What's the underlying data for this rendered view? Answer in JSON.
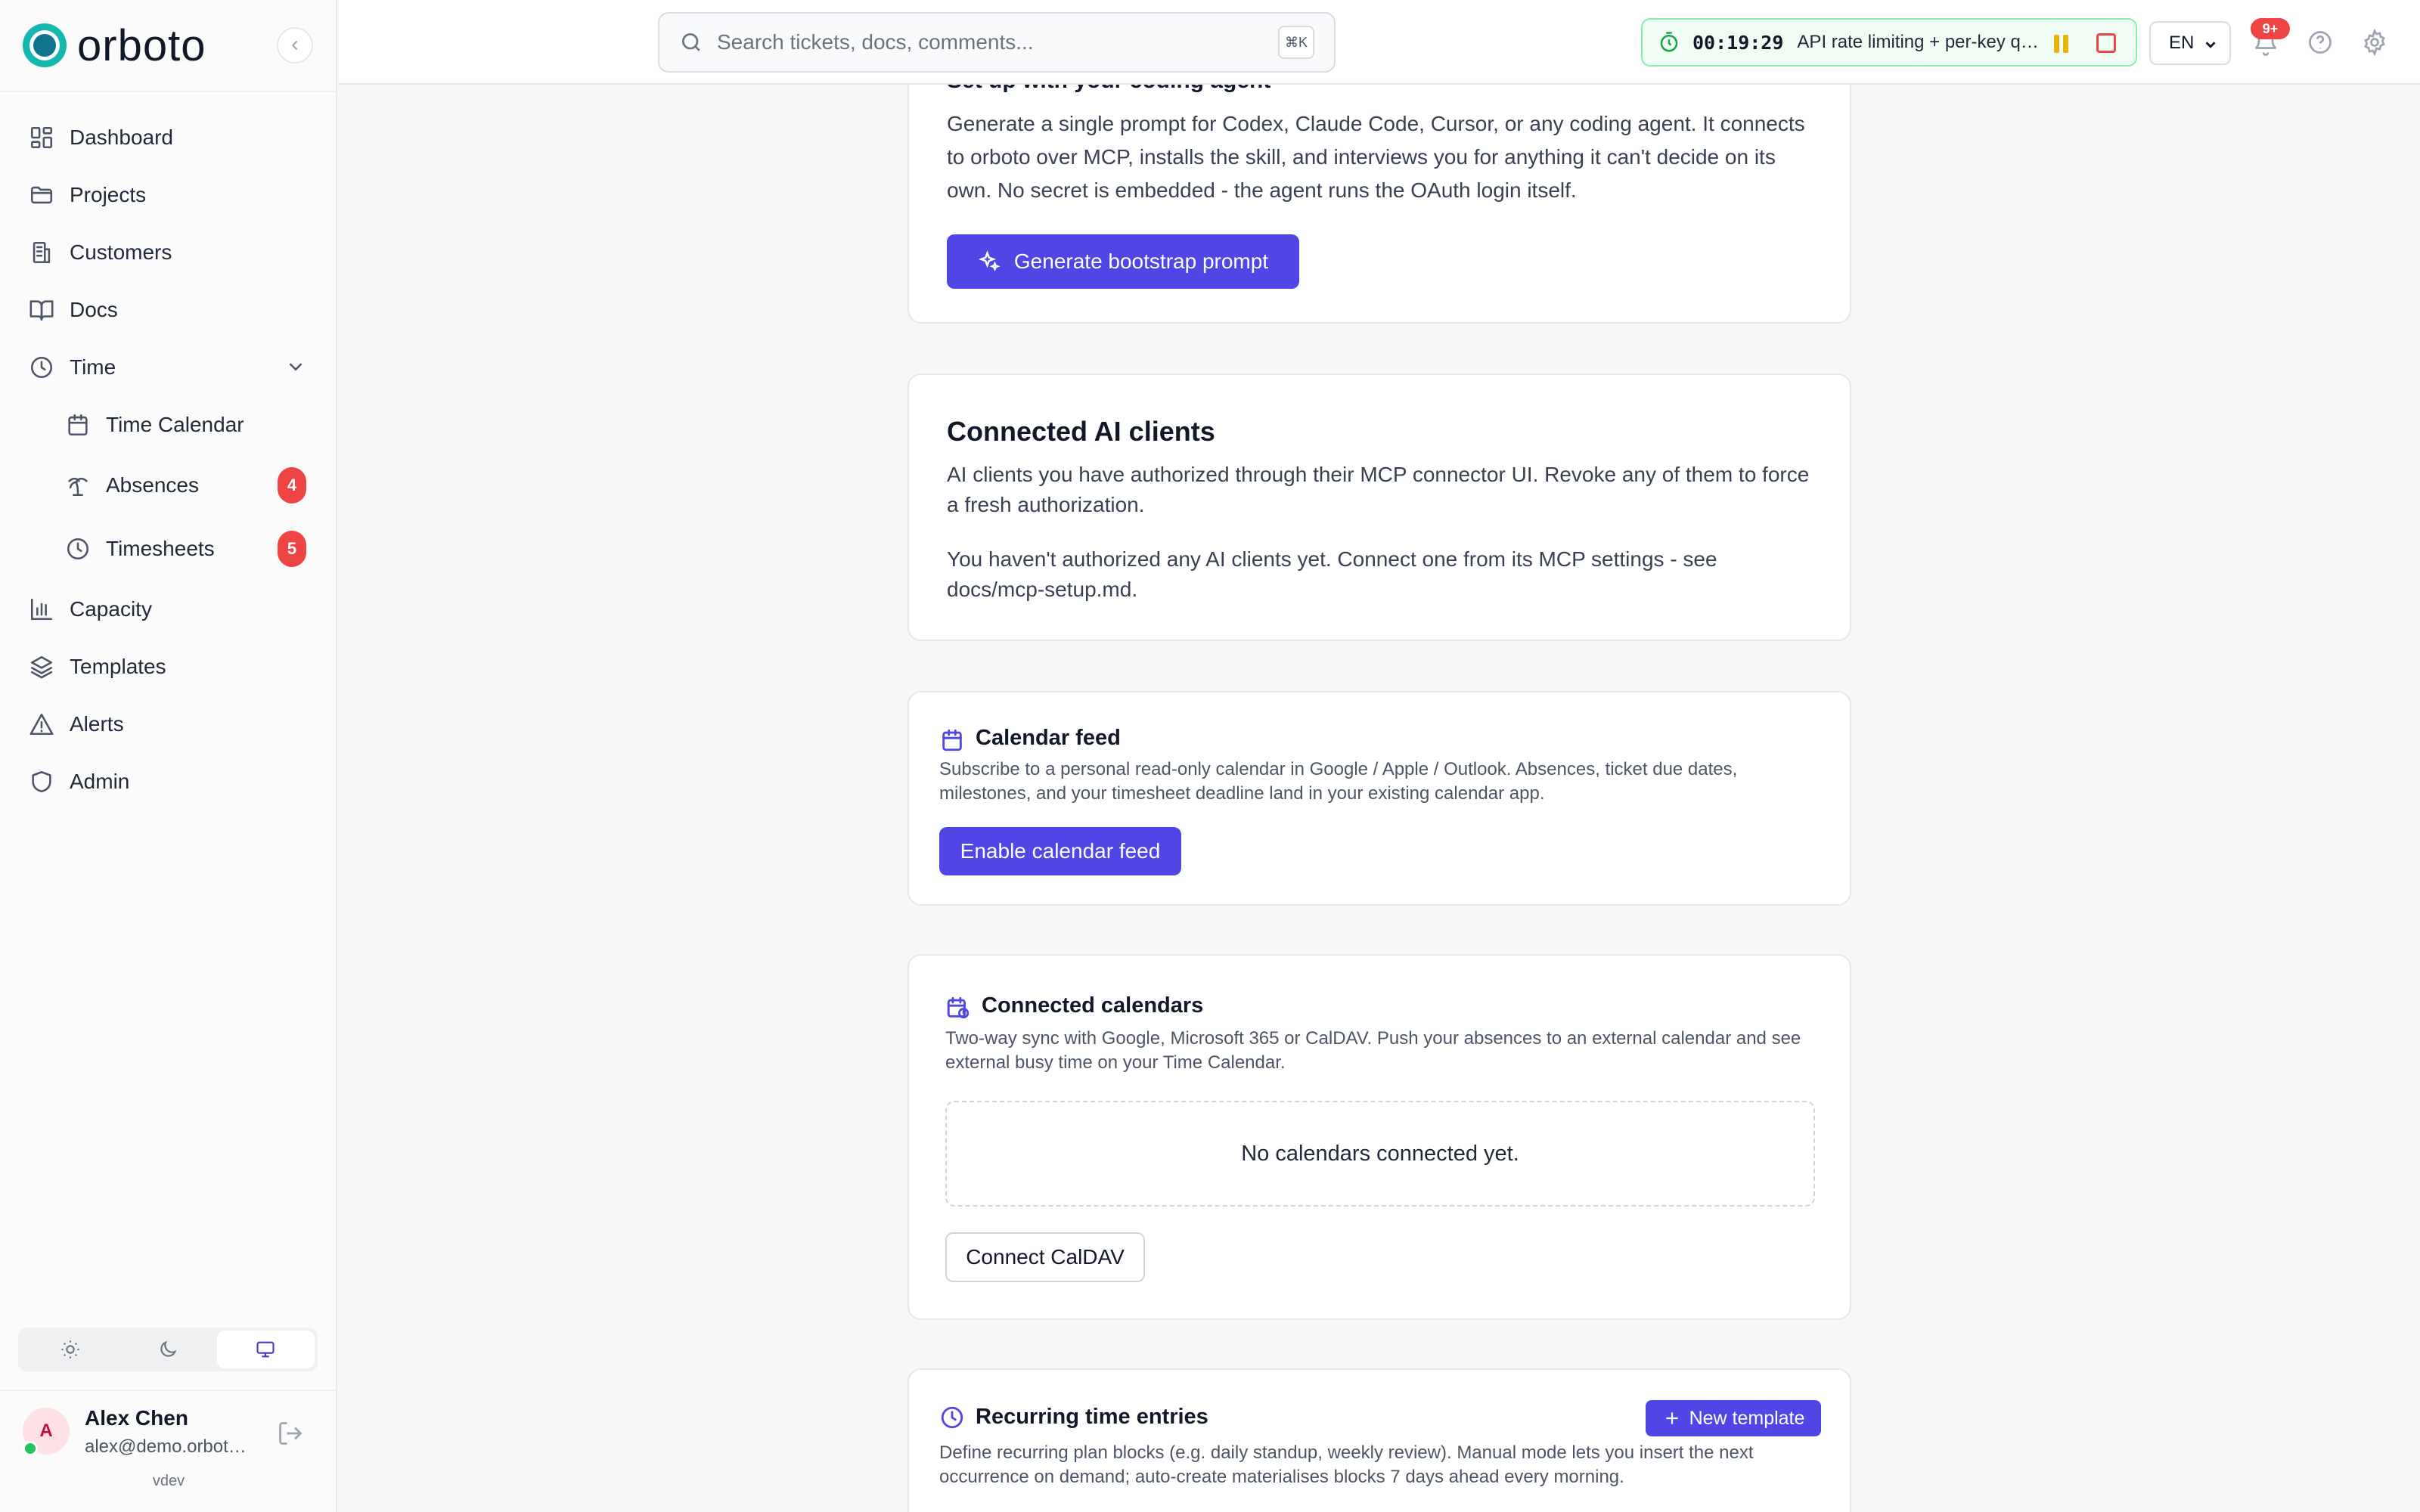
{
  "app": {
    "logo_text": "orboto",
    "version": "vdev"
  },
  "sidebar": {
    "items": [
      {
        "label": "Dashboard",
        "icon": "dashboard-icon"
      },
      {
        "label": "Projects",
        "icon": "folder-icon"
      },
      {
        "label": "Customers",
        "icon": "building-icon"
      },
      {
        "label": "Docs",
        "icon": "book-icon"
      },
      {
        "label": "Time",
        "icon": "clock-icon",
        "expanded": true,
        "children": [
          {
            "label": "Time Calendar",
            "icon": "calendar-icon"
          },
          {
            "label": "Absences",
            "icon": "palm-tree-icon",
            "badge": "4"
          },
          {
            "label": "Timesheets",
            "icon": "clock-icon",
            "badge": "5"
          }
        ]
      },
      {
        "label": "Capacity",
        "icon": "bar-chart-icon"
      },
      {
        "label": "Templates",
        "icon": "layers-icon"
      },
      {
        "label": "Alerts",
        "icon": "alert-triangle-icon"
      },
      {
        "label": "Admin",
        "icon": "shield-icon"
      }
    ],
    "theme_options": [
      "light",
      "dark",
      "system"
    ],
    "theme_selected": "system"
  },
  "user": {
    "initial": "A",
    "name": "Alex Chen",
    "email": "alex@demo.orboto.dev",
    "status": "online"
  },
  "topbar": {
    "search_placeholder": "Search tickets, docs, comments...",
    "search_shortcut": "⌘K",
    "timer": {
      "elapsed": "00:19:29",
      "task": "API rate limiting + per-key quotas"
    },
    "language": "EN",
    "notification_badge": "9+"
  },
  "main": {
    "coding_agent": {
      "title": "Set up with your coding agent",
      "description": "Generate a single prompt for Codex, Claude Code, Cursor, or any coding agent. It connects to orboto over MCP, installs the skill, and interviews you for anything it can't decide on its own. No secret is embedded - the agent runs the OAuth login itself.",
      "button": "Generate bootstrap prompt"
    },
    "ai_clients": {
      "title": "Connected AI clients",
      "description": "AI clients you have authorized through their MCP connector UI. Revoke any of them to force a fresh authorization.",
      "empty": "You haven't authorized any AI clients yet. Connect one from its MCP settings - see docs/mcp-setup.md."
    },
    "calendar_feed": {
      "title": "Calendar feed",
      "description": "Subscribe to a personal read-only calendar in Google / Apple / Outlook. Absences, ticket due dates, milestones, and your timesheet deadline land in your existing calendar app.",
      "button": "Enable calendar feed"
    },
    "connected_calendars": {
      "title": "Connected calendars",
      "description": "Two-way sync with Google, Microsoft 365 or CalDAV. Push your absences to an external calendar and see external busy time on your Time Calendar.",
      "empty": "No calendars connected yet.",
      "button": "Connect CalDAV"
    },
    "recurring": {
      "title": "Recurring time entries",
      "button": "New template",
      "description": "Define recurring plan blocks (e.g. daily standup, weekly review). Manual mode lets you insert the next occurrence on demand; auto-create materialises blocks 7 days ahead every morning."
    }
  },
  "colors": {
    "accent": "#4f46e5",
    "badge": "#ef4444",
    "timer_border": "#86efac",
    "logo": "#14b8b0"
  }
}
